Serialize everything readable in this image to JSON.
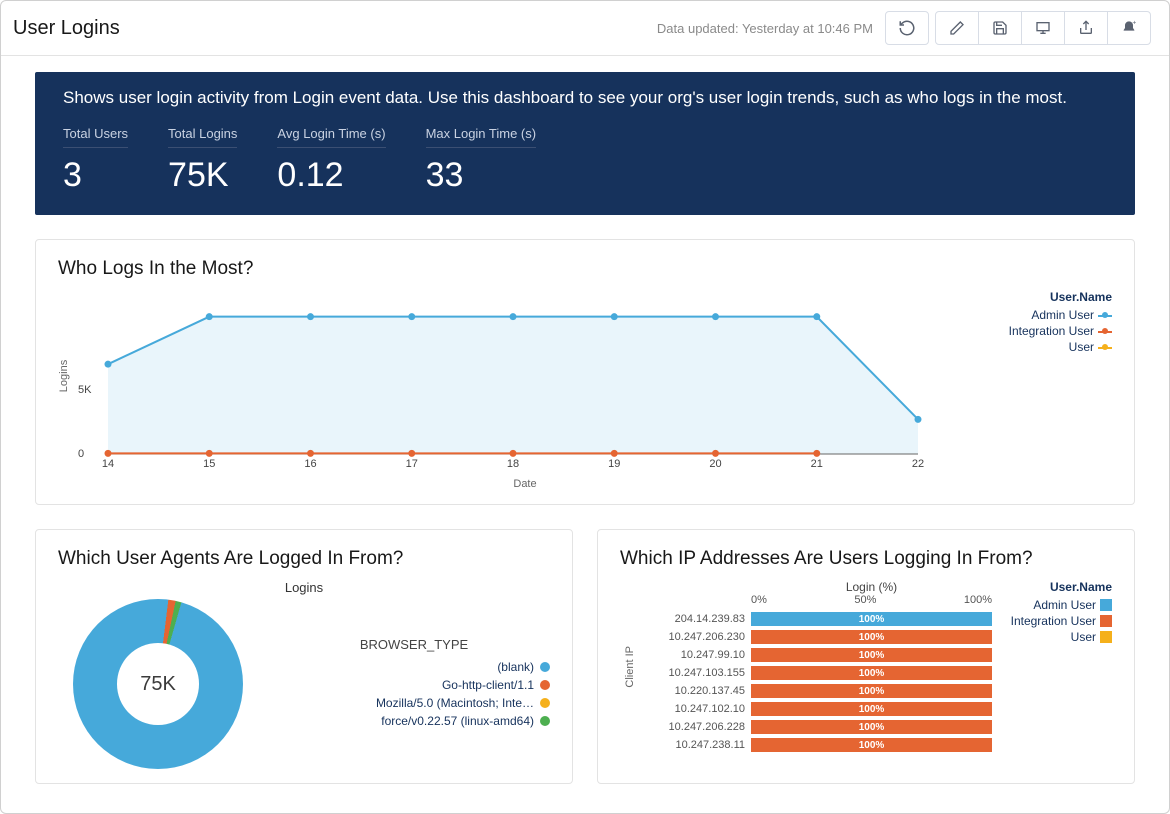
{
  "header": {
    "title": "User Logins",
    "data_updated": "Data updated: Yesterday at 10:46 PM"
  },
  "banner": {
    "description": "Shows user login activity from Login event data. Use this dashboard to see your org's user login trends, such as who logs in the most.",
    "items": [
      {
        "label": "Total Users",
        "value": "3"
      },
      {
        "label": "Total Logins",
        "value": "75K"
      },
      {
        "label": "Avg Login Time (s)",
        "value": "0.12"
      },
      {
        "label": "Max Login Time (s)",
        "value": "33"
      }
    ]
  },
  "panels": {
    "line": {
      "title": "Who Logs In the Most?",
      "legend_title": "User.Name",
      "xlabel": "Date",
      "ylabel": "Logins"
    },
    "donut": {
      "title": "Which User Agents Are Logged In From?",
      "metric_label": "Logins",
      "legend_title": "BROWSER_TYPE",
      "center": "75K"
    },
    "ip": {
      "title": "Which IP Addresses Are Users Logging In From?",
      "axis_title": "Login (%)",
      "legend_title": "User.Name",
      "ylabel": "Client IP",
      "ticks": [
        "0%",
        "50%",
        "100%"
      ]
    }
  },
  "colors": {
    "admin": "#46a9da",
    "integration": "#e56532",
    "user": "#f5b01b",
    "green": "#4daf50"
  },
  "chart_data": [
    {
      "id": "who_logs_in",
      "type": "line",
      "title": "Who Logs In the Most?",
      "xlabel": "Date",
      "ylabel": "Logins",
      "categories": [
        14,
        15,
        16,
        17,
        18,
        19,
        20,
        21,
        22
      ],
      "y_ticks": [
        0,
        5000
      ],
      "y_tick_labels": [
        "0",
        "5K"
      ],
      "ylim": [
        0,
        12000
      ],
      "legend_title": "User.Name",
      "series": [
        {
          "name": "Admin User",
          "color": "#46a9da",
          "values": [
            7000,
            10700,
            10700,
            10700,
            10700,
            10700,
            10700,
            10700,
            2700
          ],
          "area": true
        },
        {
          "name": "Integration User",
          "color": "#e56532",
          "values": [
            50,
            50,
            50,
            50,
            50,
            50,
            50,
            50,
            null
          ]
        },
        {
          "name": "User",
          "color": "#f5b01b",
          "values": [
            null,
            null,
            null,
            null,
            null,
            null,
            null,
            null,
            null
          ]
        }
      ]
    },
    {
      "id": "user_agents",
      "type": "donut",
      "title": "Which User Agents Are Logged In From?",
      "metric_label": "Logins",
      "center_label": "75K",
      "legend_title": "BROWSER_TYPE",
      "slices": [
        {
          "name": "(blank)",
          "color": "#46a9da",
          "percent": 97
        },
        {
          "name": "Go-http-client/1.1",
          "color": "#e56532",
          "percent": 1.5
        },
        {
          "name": "Mozilla/5.0 (Macintosh; Inte…",
          "color": "#f5b01b",
          "percent": 0.5
        },
        {
          "name": "force/v0.22.57 (linux-amd64)",
          "color": "#4daf50",
          "percent": 1
        }
      ]
    },
    {
      "id": "ip_addresses",
      "type": "bar",
      "orientation": "horizontal",
      "stacked": true,
      "title": "Which IP Addresses Are Users Logging In From?",
      "xlabel": "Login (%)",
      "ylabel": "Client IP",
      "xlim": [
        0,
        100
      ],
      "x_ticks": [
        0,
        50,
        100
      ],
      "legend_title": "User.Name",
      "categories": [
        "204.14.239.83",
        "10.247.206.230",
        "10.247.99.10",
        "10.247.103.155",
        "10.220.137.45",
        "10.247.102.10",
        "10.247.206.228",
        "10.247.238.11"
      ],
      "series": [
        {
          "name": "Admin User",
          "color": "#46a9da",
          "values": [
            100,
            0,
            0,
            0,
            0,
            0,
            0,
            0
          ]
        },
        {
          "name": "Integration User",
          "color": "#e56532",
          "values": [
            0,
            100,
            100,
            100,
            100,
            100,
            100,
            100
          ]
        },
        {
          "name": "User",
          "color": "#f5b01b",
          "values": [
            0,
            0,
            0,
            0,
            0,
            0,
            0,
            0
          ]
        }
      ],
      "bar_label": "100%"
    }
  ]
}
